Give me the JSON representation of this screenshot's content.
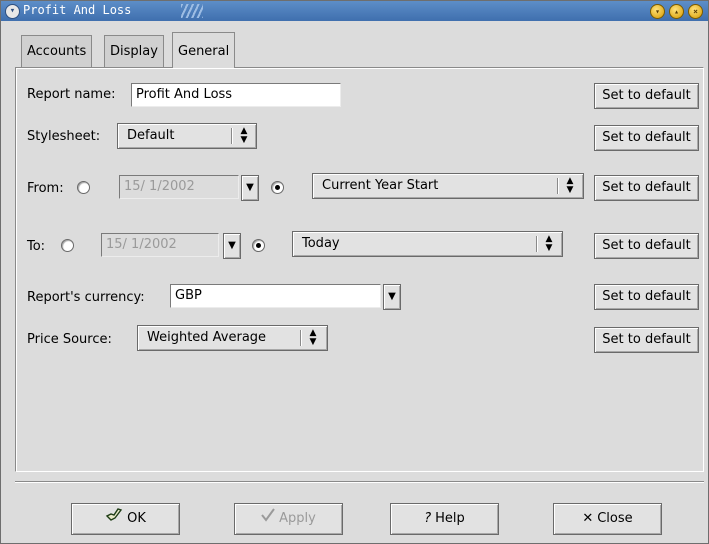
{
  "window": {
    "title": "Profit And Loss"
  },
  "tabs": [
    {
      "label": "Accounts",
      "active": false
    },
    {
      "label": "Display",
      "active": false
    },
    {
      "label": "General",
      "active": true
    }
  ],
  "general": {
    "report_name": {
      "label": "Report name:",
      "value": "Profit And Loss"
    },
    "stylesheet": {
      "label": "Stylesheet:",
      "value": "Default"
    },
    "from": {
      "label": "From:",
      "date": "15/ 1/2002",
      "absolute_selected": false,
      "relative": "Current Year Start"
    },
    "to": {
      "label": "To:",
      "date": "15/ 1/2002",
      "absolute_selected": false,
      "relative": "Today"
    },
    "currency": {
      "label": "Report's currency:",
      "value": "GBP"
    },
    "price_source": {
      "label": "Price Source:",
      "value": "Weighted Average"
    },
    "set_default_label": "Set to default"
  },
  "buttons": {
    "ok": "OK",
    "apply": "Apply",
    "help": "Help",
    "close": "Close"
  },
  "icons": {
    "ok": "ok-hand-icon",
    "apply": "checkmark-icon",
    "help": "question-icon",
    "close": "x-icon"
  },
  "colors": {
    "titlebar": "#4a7cbf",
    "dialog_bg": "#dcdcdc"
  }
}
